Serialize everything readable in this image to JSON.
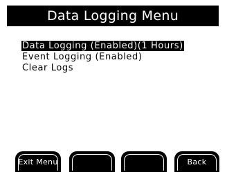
{
  "header": {
    "title": "Data Logging Menu"
  },
  "menu": {
    "items": [
      {
        "label": "Data Logging (Enabled)(1 Hours)",
        "selected": true
      },
      {
        "label": "Event Logging (Enabled)",
        "selected": false
      },
      {
        "label": "Clear Logs",
        "selected": false
      }
    ]
  },
  "softkeys": {
    "key1": "Exit Menu",
    "key2": "",
    "key3": "",
    "key4": "Back"
  },
  "colors": {
    "background": "#ffffff",
    "foreground": "#000000",
    "inverse_text": "#ffffff"
  }
}
